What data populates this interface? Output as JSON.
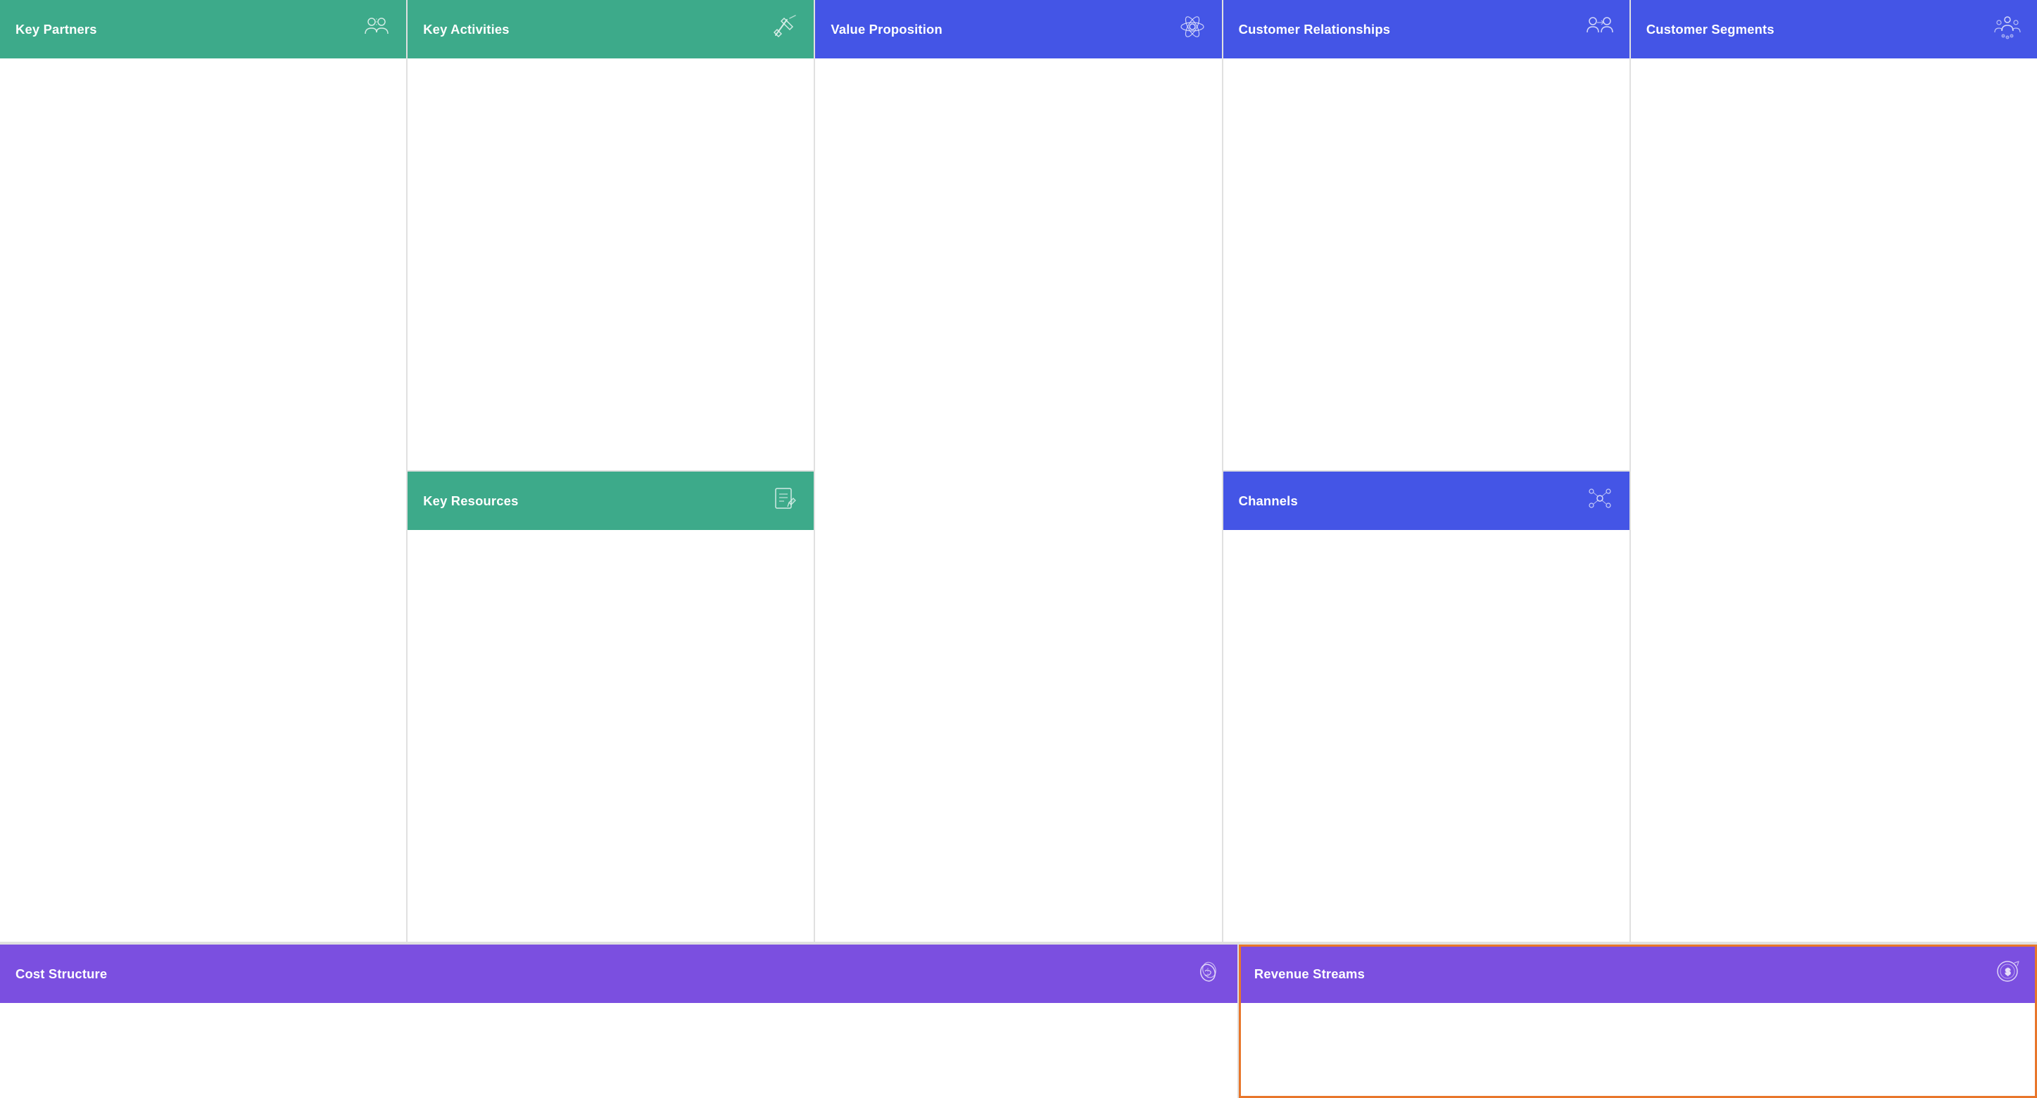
{
  "cells": {
    "key_partners": {
      "title": "Key Partners",
      "color": "teal",
      "icon": "partners-icon"
    },
    "key_activities": {
      "title": "Key Activities",
      "color": "teal",
      "icon": "activities-icon"
    },
    "key_resources": {
      "title": "Key Resources",
      "color": "teal",
      "icon": "resources-icon"
    },
    "value_proposition": {
      "title": "Value Proposition",
      "color": "blue",
      "icon": "value-icon"
    },
    "customer_relationships": {
      "title": "Customer Relationships",
      "color": "blue",
      "icon": "relationships-icon"
    },
    "channels": {
      "title": "Channels",
      "color": "blue",
      "icon": "channels-icon"
    },
    "customer_segments": {
      "title": "Customer Segments",
      "color": "blue",
      "icon": "segments-icon"
    },
    "cost_structure": {
      "title": "Cost Structure",
      "color": "purple",
      "icon": "cost-icon"
    },
    "revenue_streams": {
      "title": "Revenue Streams",
      "color": "purple",
      "icon": "revenue-icon"
    }
  }
}
